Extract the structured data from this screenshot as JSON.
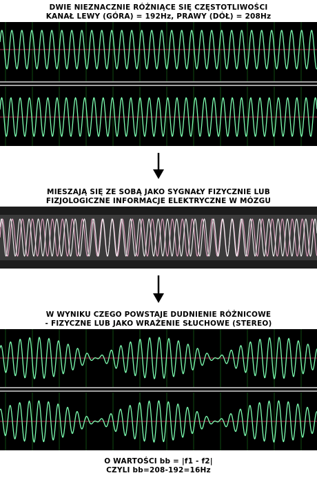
{
  "section1": {
    "caption_line1": "DWIE NIEZNACZNIE RÓŻNIĄCE SIĘ CZĘSTOTLIWOŚCI",
    "caption_line2": "KANAŁ LEWY (GÓRA) = 192Hz, PRAWY (DÓŁ) = 208Hz"
  },
  "section2": {
    "caption_line1": "MIESZAJĄ SIĘ ZE SOBĄ JAKO SYGNAŁY FIZYCZNIE LUB",
    "caption_line2": "FIZJOLOGICZNE INFORMACJE ELEKTRYCZNE W MÓZGU"
  },
  "section3": {
    "caption_line1": "W WYNIKU CZEGO POWSTAJE DUDNIENIE RÓŻNICOWE",
    "caption_line2": "- FIZYCZNE LUB JAKO WRAŻENIE SŁUCHOWE (STEREO)"
  },
  "footer": {
    "line1": "O WARTOŚCI bb = |f1 - f2|",
    "line2": "CZYLI bb=208-192=16Hz"
  },
  "signals": {
    "left_hz": 192,
    "right_hz": 208,
    "beat_hz": 16
  },
  "colors": {
    "background": "#000000",
    "mixer_background": "#3a3a3a",
    "grid": "#0f4a12",
    "wave_green": "#7dffb2",
    "wave_pink": "#e8a8c8",
    "wave_white": "#f2f2f2",
    "center_line": "#b03050",
    "separator": "#d8d8d8"
  }
}
